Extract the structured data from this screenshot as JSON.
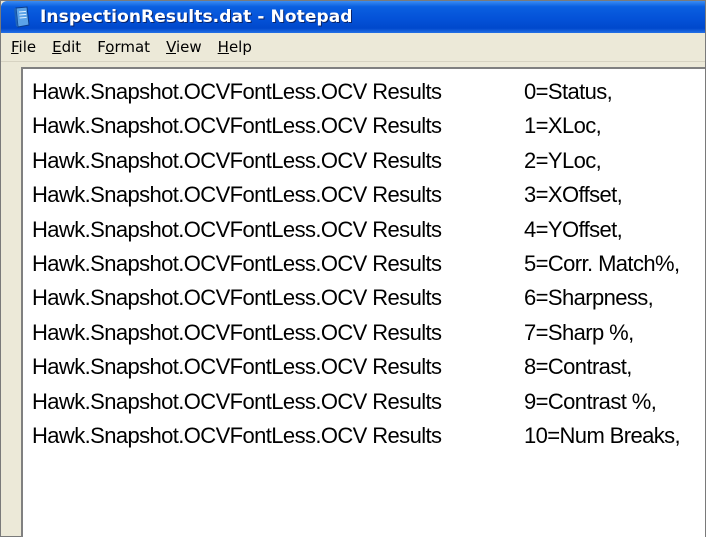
{
  "window": {
    "title": "InspectionResults.dat - Notepad",
    "icon": "notepad-icon"
  },
  "menu": {
    "items": [
      {
        "first": "F",
        "rest": "ile"
      },
      {
        "first": "E",
        "rest": "dit"
      },
      {
        "first": "F",
        "under": "o",
        "rest_before": "",
        "full": "Format"
      },
      {
        "first": "V",
        "rest": "iew"
      },
      {
        "first": "H",
        "rest": "elp"
      }
    ]
  },
  "document": {
    "lines": [
      {
        "prefix": "Hawk.Snapshot.OCVFontLess.OCV Results",
        "value": "0=Status,"
      },
      {
        "prefix": "Hawk.Snapshot.OCVFontLess.OCV Results",
        "value": "1=XLoc,"
      },
      {
        "prefix": "Hawk.Snapshot.OCVFontLess.OCV Results",
        "value": "2=YLoc,"
      },
      {
        "prefix": "Hawk.Snapshot.OCVFontLess.OCV Results",
        "value": "3=XOffset,"
      },
      {
        "prefix": "Hawk.Snapshot.OCVFontLess.OCV Results",
        "value": "4=YOffset,"
      },
      {
        "prefix": "Hawk.Snapshot.OCVFontLess.OCV Results",
        "value": "5=Corr. Match%,"
      },
      {
        "prefix": "Hawk.Snapshot.OCVFontLess.OCV Results",
        "value": "6=Sharpness,"
      },
      {
        "prefix": "Hawk.Snapshot.OCVFontLess.OCV Results",
        "value": "7=Sharp %,"
      },
      {
        "prefix": "Hawk.Snapshot.OCVFontLess.OCV Results",
        "value": "8=Contrast,"
      },
      {
        "prefix": "Hawk.Snapshot.OCVFontLess.OCV Results",
        "value": "9=Contrast %,"
      },
      {
        "prefix": "Hawk.Snapshot.OCVFontLess.OCV Results",
        "value": "10=Num Breaks,"
      }
    ]
  }
}
